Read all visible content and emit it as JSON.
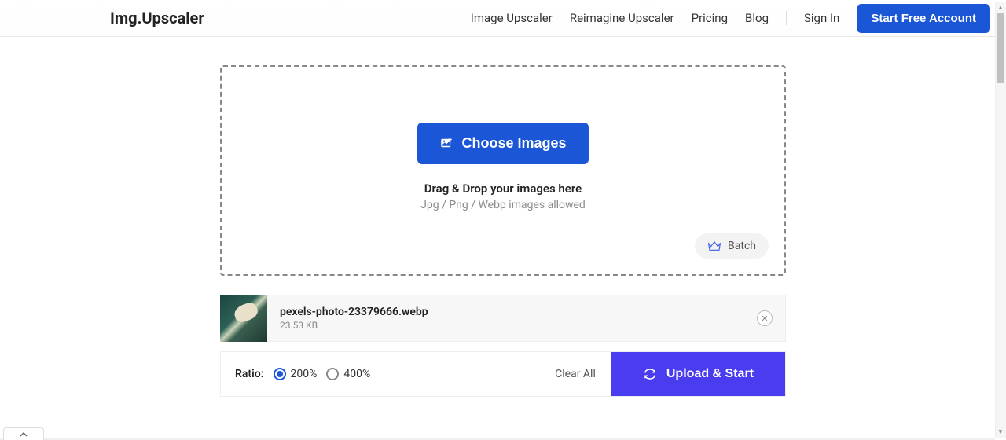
{
  "header": {
    "logo": "Img.Upscaler",
    "nav": {
      "image_upscaler": "Image Upscaler",
      "reimagine_upscaler": "Reimagine Upscaler",
      "pricing": "Pricing",
      "blog": "Blog",
      "sign_in": "Sign In",
      "start_free": "Start Free Account"
    }
  },
  "dropzone": {
    "choose_button": "Choose Images",
    "drag_text": "Drag & Drop your images here",
    "formats_text": "Jpg / Png / Webp images allowed",
    "batch_label": "Batch"
  },
  "file": {
    "name": "pexels-photo-23379666.webp",
    "size": "23.53 KB"
  },
  "controls": {
    "ratio_label": "Ratio:",
    "option_200": "200%",
    "option_400": "400%",
    "clear_all": "Clear All",
    "upload_start": "Upload & Start"
  }
}
